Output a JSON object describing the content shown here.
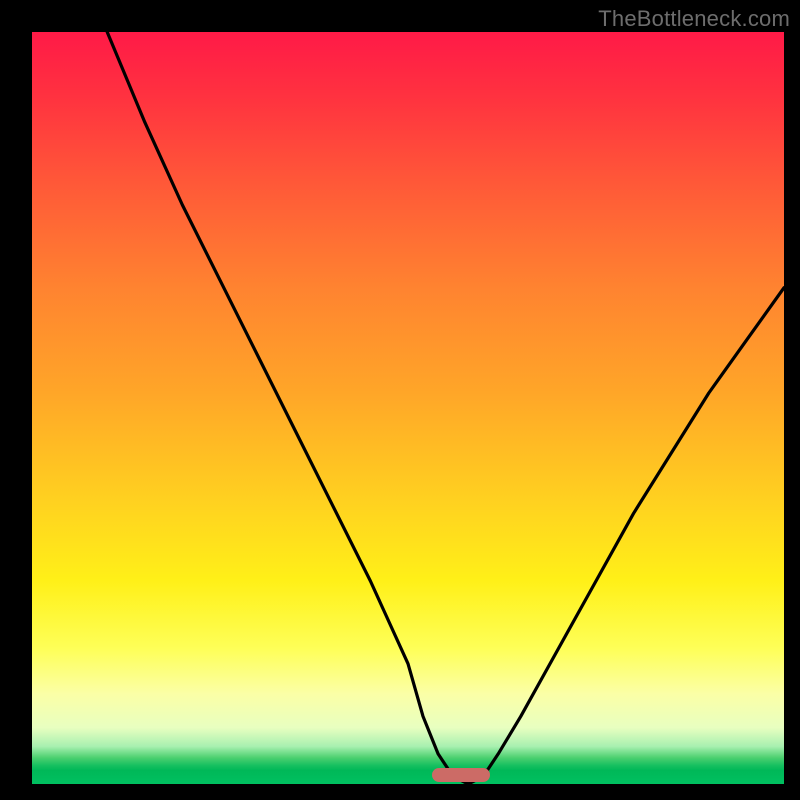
{
  "watermark": "TheBottleneck.com",
  "colors": {
    "curve": "#000000",
    "marker": "#cc6b66",
    "frame": "#000000"
  },
  "chart_data": {
    "type": "line",
    "title": "",
    "xlabel": "",
    "ylabel": "",
    "xlim": [
      0,
      100
    ],
    "ylim": [
      0,
      100
    ],
    "series": [
      {
        "name": "bottleneck-curve",
        "x": [
          10,
          15,
          20,
          25,
          30,
          35,
          40,
          45,
          50,
          52,
          54,
          56,
          58,
          60,
          62,
          65,
          70,
          75,
          80,
          85,
          90,
          95,
          100
        ],
        "values": [
          100,
          88,
          77,
          67,
          57,
          47,
          37,
          27,
          16,
          9,
          4,
          1,
          0,
          1,
          4,
          9,
          18,
          27,
          36,
          44,
          52,
          59,
          66
        ]
      }
    ],
    "annotations": [
      {
        "name": "optimum-marker",
        "x": 57,
        "y": 0,
        "shape": "pill"
      }
    ],
    "background_gradient": {
      "top": "#ff1a47",
      "mid": "#fff018",
      "bottom": "#00c060"
    }
  }
}
